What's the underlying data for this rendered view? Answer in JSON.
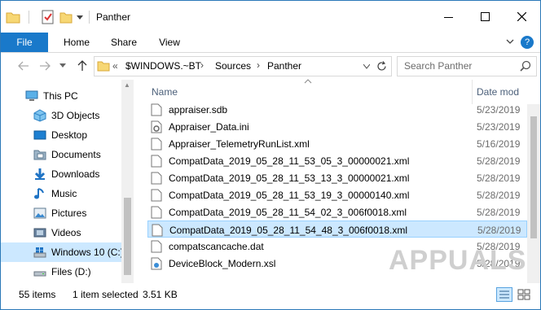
{
  "window": {
    "title": "Panther"
  },
  "ribbon": {
    "tabs": [
      {
        "label": "File"
      },
      {
        "label": "Home"
      },
      {
        "label": "Share"
      },
      {
        "label": "View"
      }
    ],
    "help_label": "?"
  },
  "address": {
    "prefix": "«",
    "crumbs": [
      "$WINDOWS.~BT",
      "Sources",
      "Panther"
    ],
    "separator": "›"
  },
  "search": {
    "placeholder": "Search Panther"
  },
  "nav": {
    "items": [
      {
        "label": "This PC",
        "icon": "computer-icon"
      },
      {
        "label": "3D Objects",
        "icon": "cube-icon"
      },
      {
        "label": "Desktop",
        "icon": "desktop-icon"
      },
      {
        "label": "Documents",
        "icon": "documents-icon"
      },
      {
        "label": "Downloads",
        "icon": "download-arrow-icon"
      },
      {
        "label": "Music",
        "icon": "music-note-icon"
      },
      {
        "label": "Pictures",
        "icon": "pictures-icon"
      },
      {
        "label": "Videos",
        "icon": "videos-icon"
      },
      {
        "label": "Windows 10 (C:)",
        "icon": "windows-drive-icon",
        "selected": true
      },
      {
        "label": "Files (D:)",
        "icon": "drive-icon"
      }
    ]
  },
  "columns": {
    "name": "Name",
    "date": "Date mod"
  },
  "files": [
    {
      "name": "appraiser.sdb",
      "date": "5/23/2019",
      "icon": "file-icon"
    },
    {
      "name": "Appraiser_Data.ini",
      "date": "5/23/2019",
      "icon": "settings-file-icon"
    },
    {
      "name": "Appraiser_TelemetryRunList.xml",
      "date": "5/16/2019",
      "icon": "file-icon"
    },
    {
      "name": "CompatData_2019_05_28_11_53_05_3_00000021.xml",
      "date": "5/28/2019",
      "icon": "file-icon"
    },
    {
      "name": "CompatData_2019_05_28_11_53_13_3_00000021.xml",
      "date": "5/28/2019",
      "icon": "file-icon"
    },
    {
      "name": "CompatData_2019_05_28_11_53_19_3_00000140.xml",
      "date": "5/28/2019",
      "icon": "file-icon"
    },
    {
      "name": "CompatData_2019_05_28_11_54_02_3_006f0018.xml",
      "date": "5/28/2019",
      "icon": "file-icon"
    },
    {
      "name": "CompatData_2019_05_28_11_54_48_3_006f0018.xml",
      "date": "5/28/2019",
      "icon": "file-icon",
      "selected": true
    },
    {
      "name": "compatscancache.dat",
      "date": "5/28/2019",
      "icon": "file-icon"
    },
    {
      "name": "DeviceBlock_Modern.xsl",
      "date": "5/28/2019",
      "icon": "xsl-file-icon"
    }
  ],
  "status": {
    "count": "55 items",
    "selection": "1 item selected",
    "size": "3.51 KB"
  },
  "watermark": "APPUALS",
  "colors": {
    "accent": "#1979ca",
    "selection": "#cce8ff",
    "selection_border": "#99d1ff"
  }
}
